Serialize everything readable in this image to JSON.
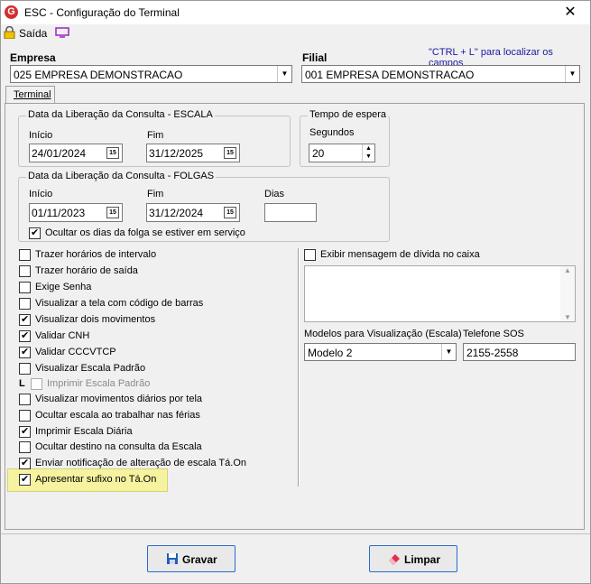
{
  "window": {
    "title": "ESC - Configuração do Terminal",
    "close": "✕",
    "app_icon": "G"
  },
  "toolbar": {
    "saida": "Saída"
  },
  "header": {
    "empresa_label": "Empresa",
    "filial_label": "Filial",
    "hint": "\"CTRL + L\" para localizar os campos",
    "empresa_value": "025 EMPRESA DEMONSTRACAO",
    "filial_value": "001 EMPRESA DEMONSTRACAO"
  },
  "tabs": [
    {
      "label": "Terminal"
    }
  ],
  "escala": {
    "title": "Data da Liberação da Consulta - ESCALA",
    "inicio_label": "Início",
    "fim_label": "Fim",
    "inicio": "24/01/2024",
    "fim": "31/12/2025"
  },
  "espera": {
    "title": "Tempo de espera",
    "segundos_label": "Segundos",
    "segundos": "20"
  },
  "folgas": {
    "title": "Data da Liberação da Consulta  - FOLGAS",
    "inicio_label": "Início",
    "fim_label": "Fim",
    "dias_label": "Dias",
    "inicio": "01/11/2023",
    "fim": "31/12/2024",
    "dias": "",
    "ocultar_label": "Ocultar os dias da folga se estiver em serviço",
    "ocultar_checked": true
  },
  "options": [
    {
      "label": "Trazer horários de intervalo",
      "checked": false
    },
    {
      "label": "Trazer horário de saída",
      "checked": false
    },
    {
      "label": "Exige Senha",
      "checked": false
    },
    {
      "label": "Visualizar a tela com código de barras",
      "checked": false
    },
    {
      "label": "Visualizar dois movimentos",
      "checked": true
    },
    {
      "label": "Validar CNH",
      "checked": true
    },
    {
      "label": "Validar CCCVTCP",
      "checked": true
    },
    {
      "label": "Visualizar Escala Padrão",
      "checked": false
    },
    {
      "label": "Imprimir Escala Padrão",
      "checked": false,
      "disabled": true
    },
    {
      "label": "Visualizar movimentos diários por tela",
      "checked": false
    },
    {
      "label": "Ocultar escala ao trabalhar nas férias",
      "checked": false
    },
    {
      "label": "Imprimir Escala Diária",
      "checked": true
    },
    {
      "label": "Ocultar destino na consulta da Escala",
      "checked": false
    },
    {
      "label": "Enviar notificação de alteração de escala Tá.On",
      "checked": true
    },
    {
      "label": "Apresentar sufixo no Tá.On",
      "checked": true
    }
  ],
  "right": {
    "divida_label": "Exibir mensagem de dívida no caixa",
    "divida_checked": false,
    "mensagem": "",
    "modelos_label": "Modelos para Visualização (Escala)",
    "modelo_value": "Modelo 2",
    "telefone_label": "Telefone SOS",
    "telefone_value": "2155-2558"
  },
  "buttons": {
    "gravar": "Gravar",
    "limpar": "Limpar"
  },
  "colors": {
    "accent": "#1a1aa0",
    "highlight": "#f5f3a0",
    "button_border": "#2a6bd0",
    "app_red": "#d32f2f"
  }
}
